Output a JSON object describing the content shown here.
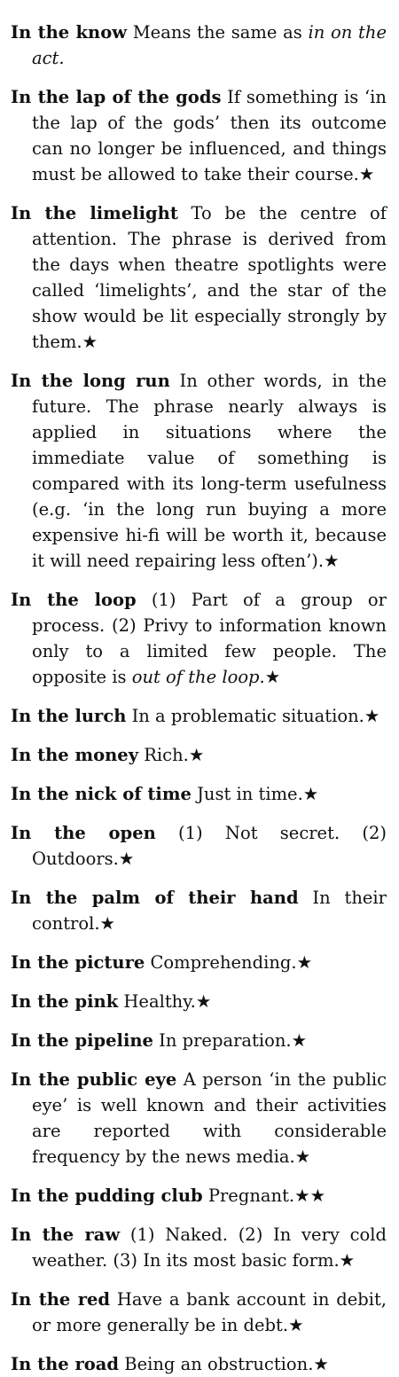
{
  "entries": [
    {
      "term": "In the know",
      "definition": "Means the same as",
      "xref": "in on the act.",
      "after": ""
    },
    {
      "term": "In the lap of the gods",
      "definition": "If something is ‘in the lap of the gods’ then its outcome can no longer be influenced, and things must be allowed to take their course.★"
    },
    {
      "term": "In the limelight",
      "definition": "To be the centre of attention. The phrase is derived from the days when theatre spotlights were called ‘limelights’, and the star of the show would be lit especially strongly by them.★"
    },
    {
      "term": "In the long run",
      "definition": "In other words, in the future. The phrase nearly always is applied in situations where the immediate value of something is compared with its long-term usefulness (e.g. ‘in the long run buying a more expensive hi-fi will be worth it, because it will need repairing less often’).★"
    },
    {
      "term": "In the loop",
      "definition": "(1) Part of a group or process. (2) Privy to information known only to a limited few people. The opposite is",
      "xref": "out of the loop.",
      "after": "★"
    },
    {
      "term": "In the lurch",
      "definition": "In a problematic situation.★"
    },
    {
      "term": "In the money",
      "definition": "Rich.★"
    },
    {
      "term": "In the nick of time",
      "definition": "Just in time.★"
    },
    {
      "term": "In the open",
      "definition": "(1) Not secret. (2) Outdoors.★"
    },
    {
      "term": "In the palm of their hand",
      "definition": "In their control.★"
    },
    {
      "term": "In the picture",
      "definition": "Comprehending.★"
    },
    {
      "term": "In the pink",
      "definition": "Healthy.★"
    },
    {
      "term": "In the pipeline",
      "definition": "In preparation.★"
    },
    {
      "term": "In the public eye",
      "definition": "A person ‘in the public eye’ is well known and their activities are reported with considerable frequency by the news media.★"
    },
    {
      "term": "In the pudding club",
      "definition": "Pregnant.★★"
    },
    {
      "term": "In the raw",
      "definition": "(1) Naked. (2) In very cold weather. (3) In its most basic form.★"
    },
    {
      "term": "In the red",
      "definition": "Have a bank account in debit, or more generally be in debt.★"
    },
    {
      "term": "In the road",
      "definition": "Being an obstruction.★"
    }
  ]
}
